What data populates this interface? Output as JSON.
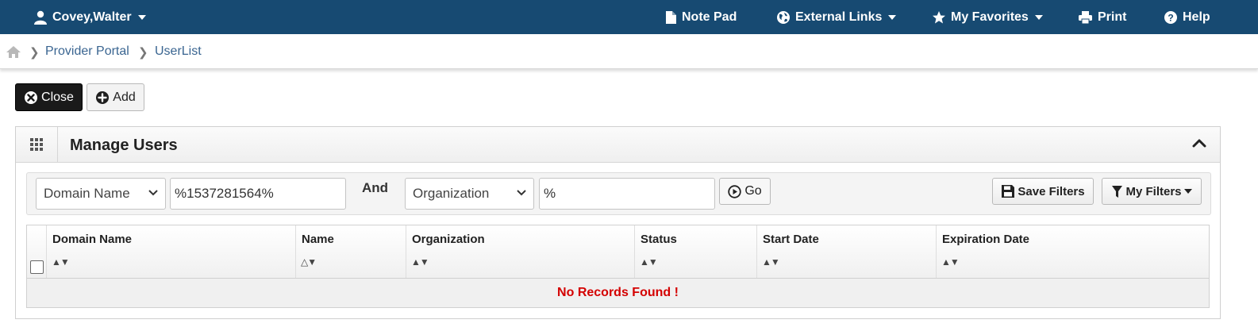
{
  "topbar": {
    "user_name": "Covey,Walter",
    "note_pad": "Note Pad",
    "external_links": "External Links",
    "my_favorites": "My Favorites",
    "print": "Print",
    "help": "Help",
    "bg_color": "#174a72"
  },
  "breadcrumb": {
    "items": [
      "Provider Portal",
      "UserList"
    ]
  },
  "actions": {
    "close_label": "Close",
    "add_label": "Add"
  },
  "panel": {
    "title": "Manage Users"
  },
  "filters": {
    "field1_selected": "Domain Name",
    "field1_value": "%1537281564%",
    "conjunction": "And",
    "field2_selected": "Organization",
    "field2_value": "%",
    "go_label": "Go",
    "save_filters_label": "Save Filters",
    "my_filters_label": "My Filters"
  },
  "table": {
    "columns": [
      "Domain Name",
      "Name",
      "Organization",
      "Status",
      "Start Date",
      "Expiration Date"
    ],
    "sort_indicators": [
      "▲▼",
      "△▼",
      "▲▼",
      "▲▼",
      "▲▼",
      "▲▼"
    ],
    "empty_message": "No Records Found !",
    "empty_color": "#d40000"
  }
}
